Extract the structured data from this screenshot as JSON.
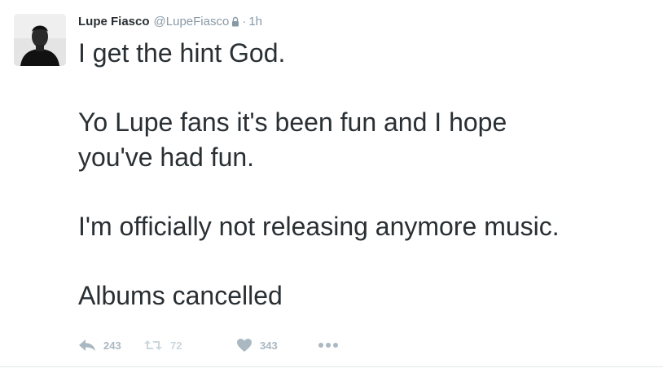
{
  "tweet": {
    "author": {
      "name": "Lupe Fiasco",
      "handle": "@LupeFiasco",
      "protected_icon": "lock-icon",
      "separator": "·",
      "time": "1h"
    },
    "paragraphs": [
      "I get the hint God.",
      "Yo Lupe fans it's been fun and I hope you've had fun.",
      "I'm officially not releasing anymore music.",
      "Albums cancelled"
    ],
    "actions": {
      "reply": {
        "icon": "reply-icon",
        "count": "243"
      },
      "retweet": {
        "icon": "retweet-icon",
        "count": "72"
      },
      "like": {
        "icon": "heart-icon",
        "count": "343"
      },
      "more": {
        "icon": "more-dots-icon"
      }
    }
  },
  "colors": {
    "text": "#292f33",
    "secondary": "#8899a6",
    "action": "#aab8c2"
  }
}
